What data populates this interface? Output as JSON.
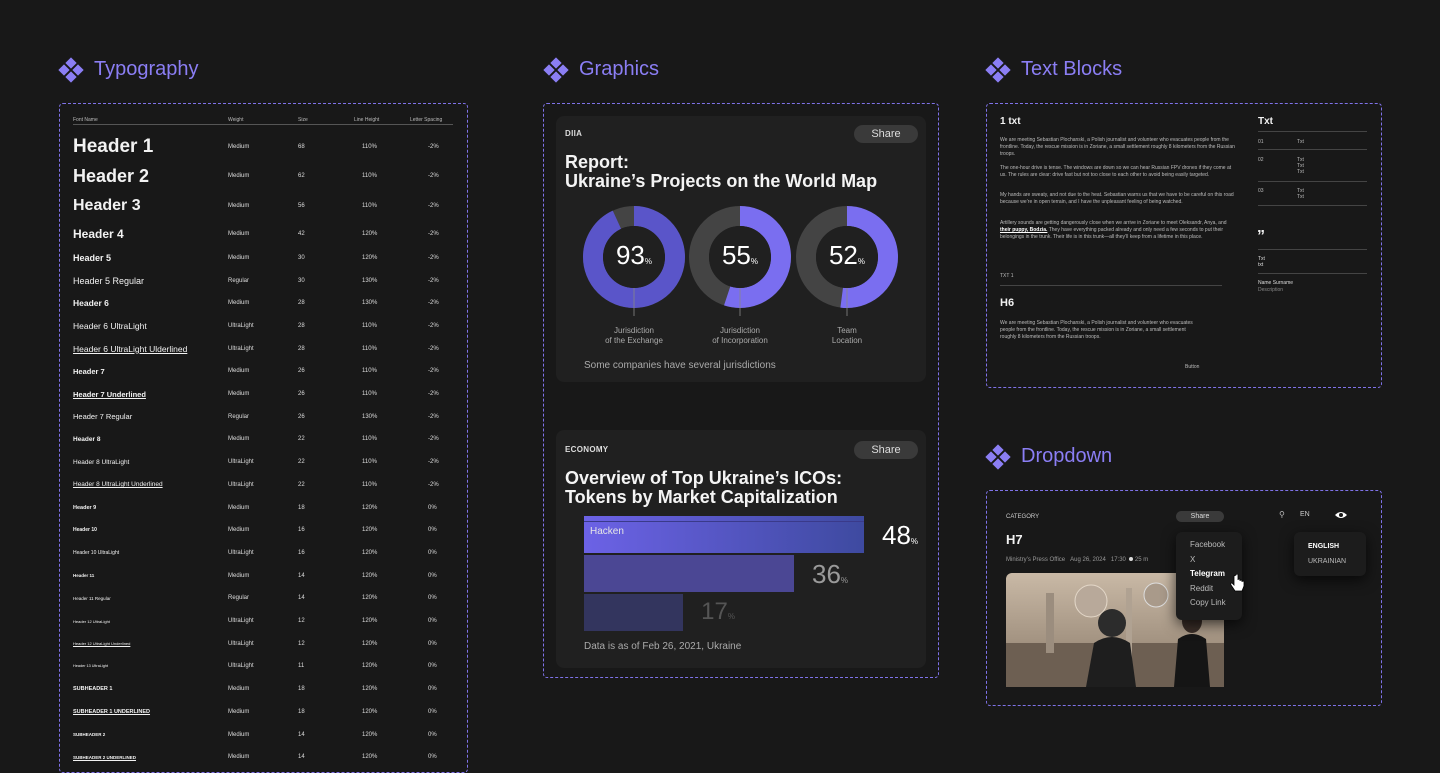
{
  "sections": {
    "typography": "Typography",
    "graphics": "Graphics",
    "text_blocks": "Text Blocks",
    "dropdown": "Dropdown"
  },
  "typography": {
    "columns": [
      "Font Name",
      "Weight",
      "Size",
      "Line Height",
      "Letter Spacing"
    ],
    "rows": [
      {
        "name": "Header 1",
        "weight": "Medium",
        "size": "68",
        "lh": "110%",
        "ls": "-2%"
      },
      {
        "name": "Header 2",
        "weight": "Medium",
        "size": "62",
        "lh": "110%",
        "ls": "-2%"
      },
      {
        "name": "Header 3",
        "weight": "Medium",
        "size": "56",
        "lh": "110%",
        "ls": "-2%"
      },
      {
        "name": "Header 4",
        "weight": "Medium",
        "size": "42",
        "lh": "120%",
        "ls": "-2%"
      },
      {
        "name": "Header 5",
        "weight": "Medium",
        "size": "30",
        "lh": "120%",
        "ls": "-2%"
      },
      {
        "name": "Header 5 Regular",
        "weight": "Regular",
        "size": "30",
        "lh": "130%",
        "ls": "-2%"
      },
      {
        "name": "Header 6",
        "weight": "Medium",
        "size": "28",
        "lh": "130%",
        "ls": "-2%"
      },
      {
        "name": "Header 6 UltraLight",
        "weight": "UltraLight",
        "size": "28",
        "lh": "110%",
        "ls": "-2%"
      },
      {
        "name": "Header 6 UltraLight Ulderlined",
        "weight": "UltraLight",
        "size": "28",
        "lh": "110%",
        "ls": "-2%"
      },
      {
        "name": "Header 7",
        "weight": "Medium",
        "size": "26",
        "lh": "110%",
        "ls": "-2%"
      },
      {
        "name": "Header 7 Underlined",
        "weight": "Medium",
        "size": "26",
        "lh": "110%",
        "ls": "-2%"
      },
      {
        "name": "Header 7 Regular",
        "weight": "Regular",
        "size": "26",
        "lh": "130%",
        "ls": "-2%"
      },
      {
        "name": "Header 8",
        "weight": "Medium",
        "size": "22",
        "lh": "110%",
        "ls": "-2%"
      },
      {
        "name": "Header 8 UltraLight",
        "weight": "UltraLight",
        "size": "22",
        "lh": "110%",
        "ls": "-2%"
      },
      {
        "name": "Header 8 UltraLight Underlined",
        "weight": "UltraLight",
        "size": "22",
        "lh": "110%",
        "ls": "-2%"
      },
      {
        "name": "Header 9",
        "weight": "Medium",
        "size": "18",
        "lh": "120%",
        "ls": "0%"
      },
      {
        "name": "Header 10",
        "weight": "Medium",
        "size": "16",
        "lh": "120%",
        "ls": "0%"
      },
      {
        "name": "Header 10 UltraLight",
        "weight": "UltraLight",
        "size": "16",
        "lh": "120%",
        "ls": "0%"
      },
      {
        "name": "Header 11",
        "weight": "Medium",
        "size": "14",
        "lh": "120%",
        "ls": "0%"
      },
      {
        "name": "Header 11 Regular",
        "weight": "Regular",
        "size": "14",
        "lh": "120%",
        "ls": "0%"
      },
      {
        "name": "Header 12 UltraLight",
        "weight": "UltraLight",
        "size": "12",
        "lh": "120%",
        "ls": "0%"
      },
      {
        "name": "Header 12 UltraLight Underlined",
        "weight": "UltraLight",
        "size": "12",
        "lh": "120%",
        "ls": "0%"
      },
      {
        "name": "Header 13 UltraLight",
        "weight": "UltraLight",
        "size": "11",
        "lh": "120%",
        "ls": "0%"
      },
      {
        "name": "SUBHEADER 1",
        "weight": "Medium",
        "size": "18",
        "lh": "120%",
        "ls": "0%"
      },
      {
        "name": "SUBHEADER 1 UNDERLINED",
        "weight": "Medium",
        "size": "18",
        "lh": "120%",
        "ls": "0%"
      },
      {
        "name": "SUBHEADER 2",
        "weight": "Medium",
        "size": "14",
        "lh": "120%",
        "ls": "0%"
      },
      {
        "name": "SUBHEADER 2 UNDERLINED",
        "weight": "Medium",
        "size": "14",
        "lh": "120%",
        "ls": "0%"
      }
    ]
  },
  "graphics": {
    "card1": {
      "kicker": "DIIA",
      "share": "Share",
      "title_line1": "Report:",
      "title_line2": "Ukraine’s Projects on the World Map",
      "note": "Some companies have several jurisdictions"
    },
    "card2": {
      "kicker": "ECONOMY",
      "share": "Share",
      "title_line1": "Overview of Top Ukraine’s ICOs:",
      "title_line2": "Tokens by Market Capitalization",
      "note": "Data is as of Feb 26, 2021, Ukraine"
    }
  },
  "chart_data": [
    {
      "type": "pie",
      "subtype": "donut",
      "categories": [
        "Jurisdiction of the Exchange",
        "Jurisdiction of Incorporation",
        "Team Location"
      ],
      "values": [
        93,
        55,
        52
      ],
      "unit": "%",
      "label_lines": [
        [
          "Jurisdiction",
          "of the Exchange"
        ],
        [
          "Jurisdiction",
          "of Incorporation"
        ],
        [
          "Team",
          "Location"
        ]
      ],
      "colors": {
        "fill": "#7a6ef0",
        "fill_dark": "#3f51b5",
        "track": "#444444"
      }
    },
    {
      "type": "bar",
      "orientation": "horizontal",
      "categories": [
        "Hacken",
        "",
        ""
      ],
      "values": [
        48,
        36,
        17
      ],
      "unit": "%",
      "colors": [
        "#6c62e6",
        "#4b4794",
        "#33355e"
      ]
    }
  ],
  "text_blocks": {
    "h1": "1 txt",
    "para1": "We are meeting Sebastian Plochanski, a Polish journalist and volunteer who evacuates people from the frontline. Today, the rescue mission is in Zoriane, a small settlement roughly 8 kilometers from the Russian troops.",
    "para2": "The one-hour drive is tense. The windows are down so we can hear Russian FPV drones if they come at us. The rules are clear: drive fast but not too close to each other to avoid being easily targeted.",
    "para3": "My hands are sweaty, and not due to the heat. Sebastian warns us that we have to be careful on this road because we’re in open terrain, and I have the unpleasant feeling of being watched.",
    "para4_a": "Artillery sounds are getting dangerously close when we arrive in Zoriane to meet Oleksandr, Anya, and ",
    "para4_link": "their puppy, Bodzia.",
    "para4_b": " They have everything packed already and only need a few seconds to put their belongings in the trunk. Their life is in this trunk—all they’ll keep from a lifetime in this place.",
    "txt1": "TXT 1",
    "h6": "H6",
    "para5": "We are meeting Sebastian Plochanski, a Polish journalist and volunteer who evacuates people from the frontline. Today, the rescue mission is in Zoriane, a small settlement roughly 8 kilometers from the Russian troops.",
    "button": "Button",
    "side_title": "Txt",
    "side_rows": [
      {
        "num": "01",
        "lines": [
          "Txt"
        ]
      },
      {
        "num": "02",
        "lines": [
          "Txt",
          "Txt",
          "Txt"
        ]
      },
      {
        "num": "03",
        "lines": [
          "Txt",
          "Txt"
        ]
      }
    ],
    "quote_mark": "”",
    "quote_lines": [
      "Txt",
      "txt"
    ],
    "author": "Name Surname",
    "author_desc": "Description"
  },
  "dropdown": {
    "category": "CATEGORY",
    "share": "Share",
    "title": "H7",
    "source": "Ministry’s Press Office",
    "date": "Aug 26, 2024",
    "time": "17:30",
    "read": "25 m",
    "lang": "EN",
    "share_menu": [
      "Facebook",
      "X",
      "Telegram",
      "Reddit",
      "Copy Link"
    ],
    "share_selected": "Telegram",
    "lang_menu": [
      "ENGLISH",
      "UKRAINIAN"
    ],
    "lang_selected": "ENGLISH"
  }
}
